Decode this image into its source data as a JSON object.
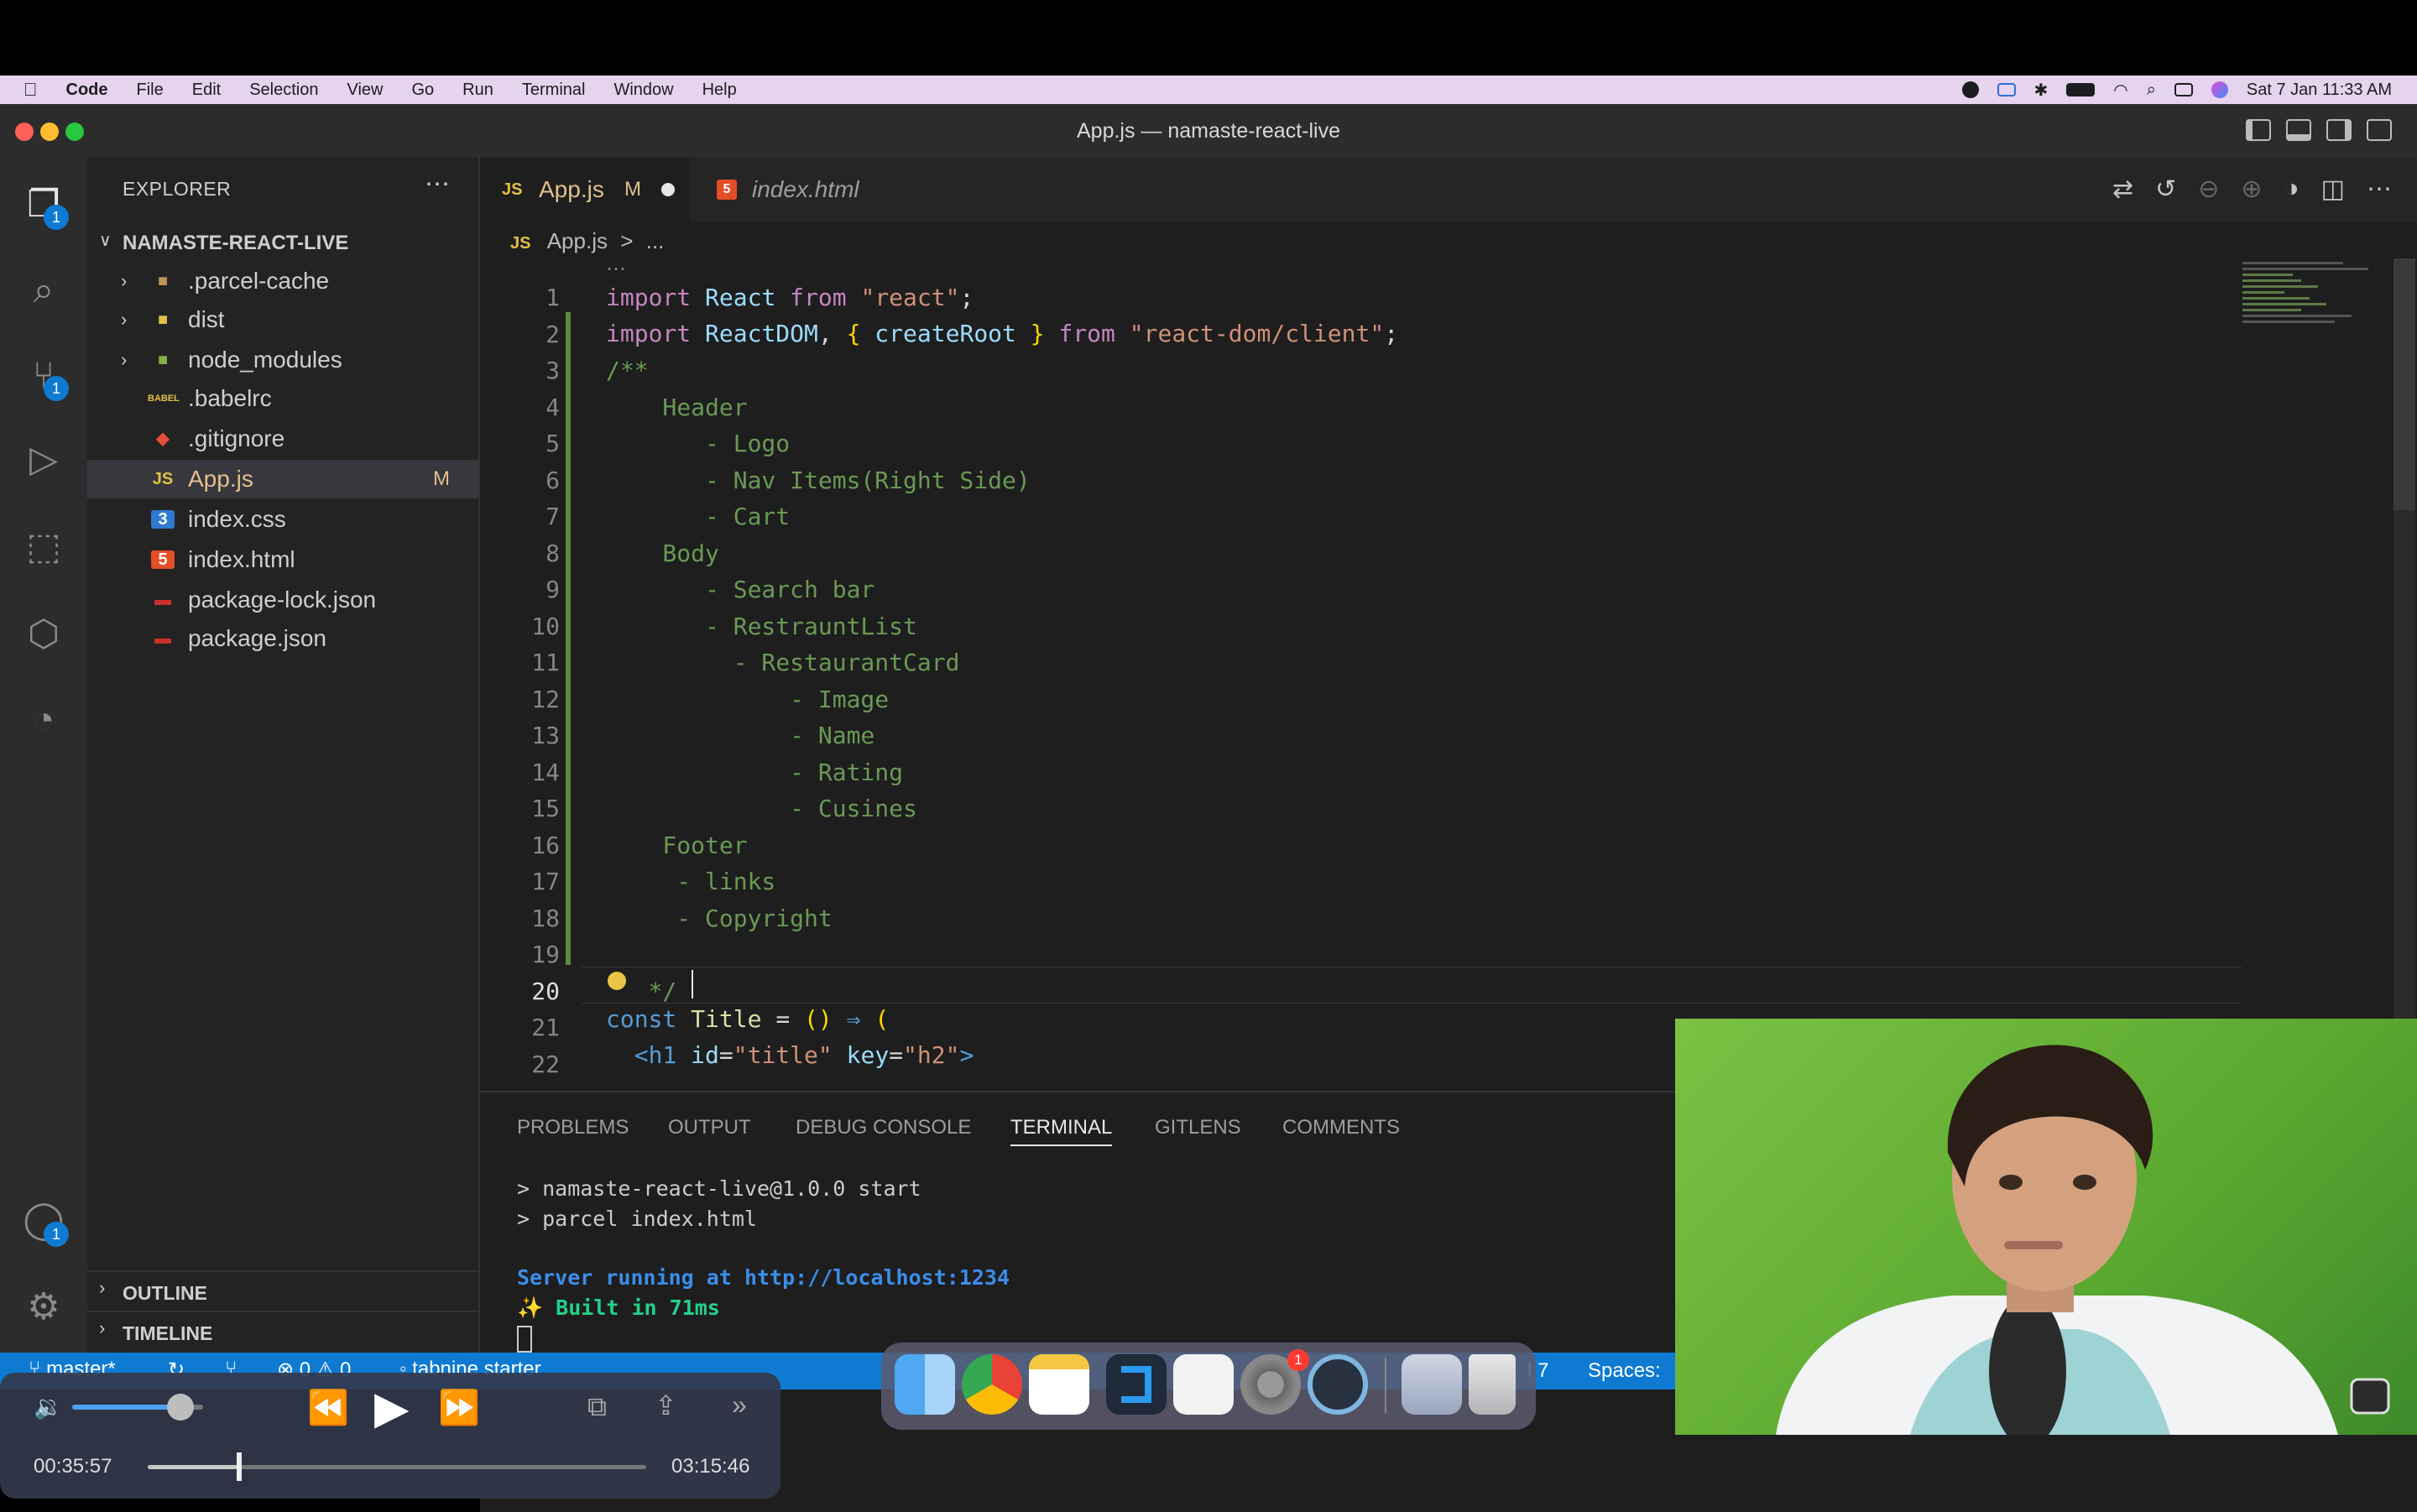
{
  "menubar": {
    "items": [
      "Code",
      "File",
      "Edit",
      "Selection",
      "View",
      "Go",
      "Run",
      "Terminal",
      "Window",
      "Help"
    ],
    "clock": "Sat 7 Jan  11:33 AM"
  },
  "window": {
    "title": "App.js — namaste-react-live"
  },
  "activity": {
    "explorer_badge": "1",
    "scm_badge": "1",
    "accounts_badge": "1"
  },
  "sidebar": {
    "header": "EXPLORER",
    "project": "NAMASTE-REACT-LIVE",
    "items": [
      {
        "label": ".parcel-cache",
        "icon": "folder-icon"
      },
      {
        "label": "dist",
        "icon": "folder-icon"
      },
      {
        "label": "node_modules",
        "icon": "folder-icon"
      },
      {
        "label": ".babelrc",
        "icon": "babel-icon"
      },
      {
        "label": ".gitignore",
        "icon": "git-icon"
      },
      {
        "label": "App.js",
        "icon": "js-icon",
        "status": "M"
      },
      {
        "label": "index.css",
        "icon": "css-icon"
      },
      {
        "label": "index.html",
        "icon": "html-icon"
      },
      {
        "label": "package-lock.json",
        "icon": "npm-icon"
      },
      {
        "label": "package.json",
        "icon": "npm-icon"
      }
    ],
    "outline": "OUTLINE",
    "timeline": "TIMELINE",
    "icon_text": {
      "js": "JS",
      "css": "3",
      "html": "5",
      "babel": "BABEL"
    }
  },
  "tabs": [
    {
      "label": "App.js",
      "status": "M",
      "icon": "JS"
    },
    {
      "label": "index.html",
      "icon": "5"
    }
  ],
  "breadcrumb": {
    "file": "App.js",
    "rest": "...",
    "js": "JS",
    "sep": ">"
  },
  "code": {
    "line_numbers": [
      "1",
      "2",
      "3",
      "4",
      "5",
      "6",
      "7",
      "8",
      "9",
      "10",
      "11",
      "12",
      "13",
      "14",
      "15",
      "16",
      "17",
      "18",
      "19",
      "20",
      "21",
      "22"
    ],
    "l1": [
      "import",
      "React",
      "from",
      "\"react\"",
      ";"
    ],
    "l2": [
      "import",
      "ReactDOM",
      ", ",
      "{",
      " createRoot ",
      "}",
      " from ",
      "\"react-dom/client\"",
      ";"
    ],
    "comment": [
      "/**",
      "    Header",
      "       - Logo",
      "       - Nav Items(Right Side)",
      "       - Cart",
      "    Body",
      "       - Search bar",
      "       - RestrauntList",
      "         - RestaurantCard",
      "             - Image",
      "             - Name",
      "             - Rating",
      "             - Cusines",
      "    Footer",
      "     - links",
      "     - Copyright",
      "",
      "   */"
    ],
    "l21": [
      "const",
      "Title",
      "=",
      "()",
      "⇒",
      "("
    ],
    "l22": [
      "<h1",
      "id",
      "=",
      "\"title\"",
      "key",
      "=",
      "\"h2\"",
      ">"
    ]
  },
  "panel": {
    "tabs": [
      "PROBLEMS",
      "OUTPUT",
      "DEBUG CONSOLE",
      "TERMINAL",
      "GITLENS",
      "COMMENTS"
    ],
    "active_tab": "TERMINAL",
    "terminal": {
      "line1": "> namaste-react-live@1.0.0 start",
      "line2": "> parcel index.html",
      "server_prefix": "Server running at ",
      "server_url": "http://localhost:1234",
      "built": "✨ Built in 71ms"
    }
  },
  "status": {
    "branch": "master*",
    "problems": "⊗ 0 ⚠ 0",
    "tabnine": "◦ tabnine starter",
    "position": "l 7",
    "spaces": "Spaces:"
  },
  "player": {
    "elapsed": "00:35:57",
    "total": "03:15:46",
    "progress": 0.184,
    "volume": 0.83
  },
  "dock": {
    "apps": [
      "finder-icon",
      "chrome-icon",
      "notes-icon",
      "vscode-icon",
      "textedit-icon",
      "system-settings-icon",
      "quicktime-icon",
      "downloads-icon",
      "trash-icon"
    ],
    "settings_badge": "1"
  },
  "colors": {
    "accent": "#0e7ad1",
    "menubar": "#e6d3ee",
    "modified": "#e2c08d"
  }
}
